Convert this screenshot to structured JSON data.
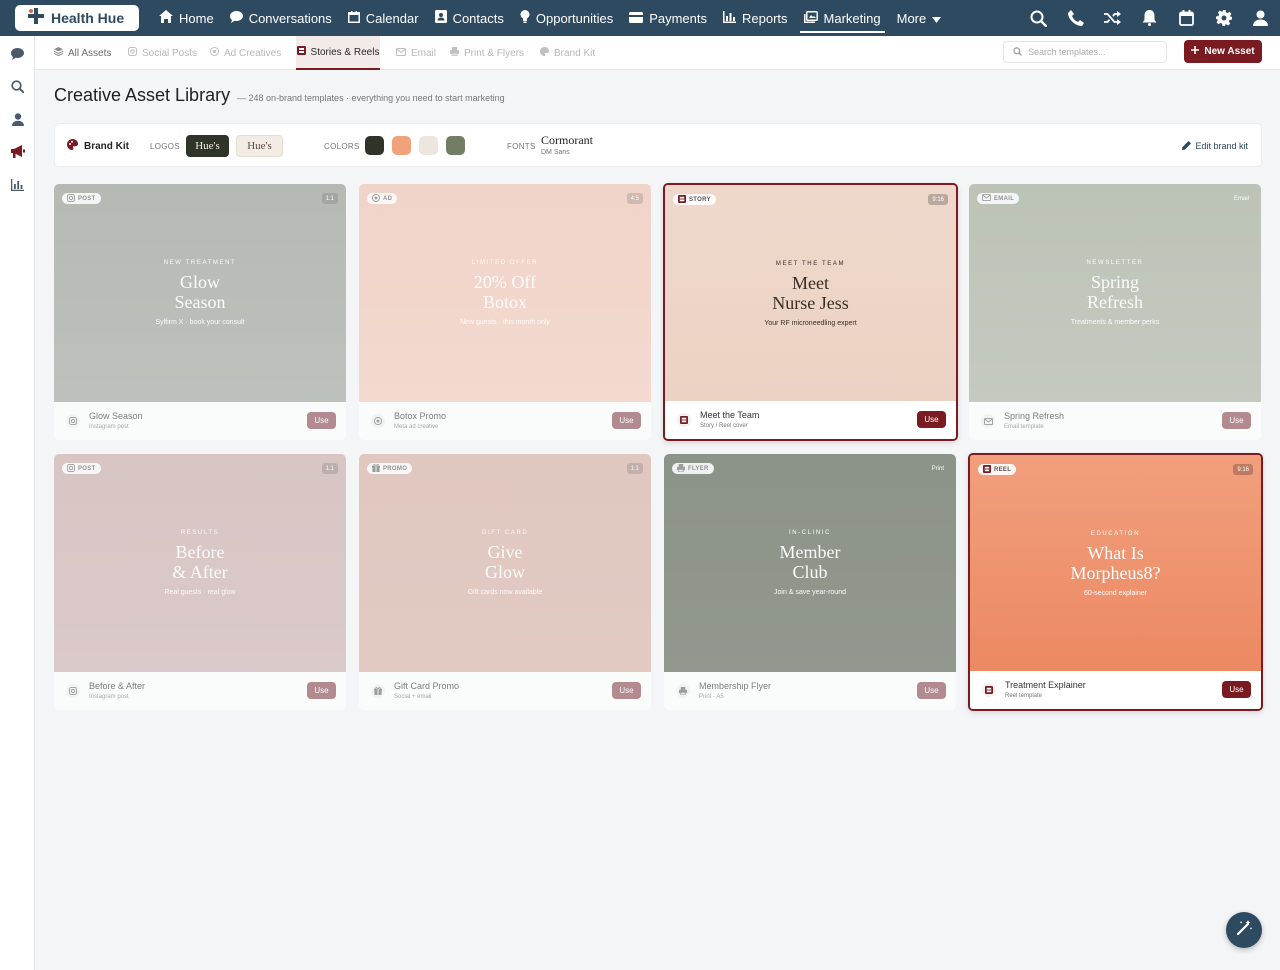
{
  "app": {
    "logo_text": "Health Hue"
  },
  "nav": {
    "items": [
      {
        "label": "Home",
        "icon": "home-icon"
      },
      {
        "label": "Conversations",
        "icon": "chat-icon"
      },
      {
        "label": "Calendar",
        "icon": "calendar-icon"
      },
      {
        "label": "Contacts",
        "icon": "contacts-icon"
      },
      {
        "label": "Opportunities",
        "icon": "lightbulb-icon"
      },
      {
        "label": "Payments",
        "icon": "credit-card-icon"
      },
      {
        "label": "Reports",
        "icon": "bar-chart-icon"
      },
      {
        "label": "Marketing",
        "icon": "marketing-icon",
        "active": true
      },
      {
        "label": "More",
        "icon": "chevron-down-icon"
      }
    ],
    "right_icons": [
      "search-icon",
      "phone-icon",
      "shuffle-icon",
      "bell-icon",
      "calendar-icon",
      "gear-icon",
      "user-icon"
    ]
  },
  "rail": {
    "icons": [
      "chat-icon",
      "search-icon",
      "user-icon",
      "megaphone-icon",
      "chart-icon"
    ]
  },
  "subnav": {
    "tabs": [
      {
        "label": "All Assets",
        "icon": "layers-icon"
      },
      {
        "label": "Social Posts",
        "icon": "instagram-icon"
      },
      {
        "label": "Ad Creatives",
        "icon": "target-icon"
      },
      {
        "label": "Stories & Reels",
        "icon": "film-icon",
        "active": true
      },
      {
        "label": "Email",
        "icon": "mail-icon"
      },
      {
        "label": "Print & Flyers",
        "icon": "printer-icon"
      },
      {
        "label": "Brand Kit",
        "icon": "palette-icon"
      }
    ],
    "search_placeholder": "Search templates...",
    "new_asset_label": "New Asset"
  },
  "header": {
    "title": "Creative Asset Library",
    "subtitle": "— 248 on-brand templates · everything you need to start marketing"
  },
  "brand_kit": {
    "title": "Brand Kit",
    "logos_label": "LOGOS",
    "logo_dark": "Hue's",
    "logo_light": "Hue's",
    "colors_label": "COLORS",
    "colors": [
      "#2f3428",
      "#f0a27a",
      "#ece6df",
      "#737d64"
    ],
    "fonts_label": "FONTS",
    "font_primary": "Cormorant",
    "font_secondary": "DM Sans",
    "edit_label": "Edit brand kit"
  },
  "cards": [
    {
      "badge": "POST",
      "badge_icon": "instagram-icon",
      "ratio": "1:1",
      "kicker": "NEW TREATMENT",
      "headline_1": "Glow",
      "headline_2": "Season",
      "tagline": "Sylfirm X · book your consult",
      "name": "Glow Season",
      "type": "Instagram post",
      "use": "Use",
      "bg": "linear-gradient(180deg,#8f968c 0%,#9da29a 100%)",
      "state": "faded",
      "footer_icon": "instagram-icon"
    },
    {
      "badge": "AD",
      "badge_icon": "target-icon",
      "ratio": "4:5",
      "kicker": "LIMITED OFFER",
      "headline_1": "20% Off",
      "headline_2": "Botox",
      "tagline": "New guests · this month only",
      "name": "Botox Promo",
      "type": "Meta ad creative",
      "use": "Use",
      "bg": "linear-gradient(180deg,#efbfad 0%,#f3c9b8 100%)",
      "state": "faded",
      "footer_icon": "target-icon"
    },
    {
      "badge": "STORY",
      "badge_icon": "film-icon",
      "ratio": "9:16",
      "kicker": "MEET THE TEAM",
      "headline_1": "Meet",
      "headline_2": "Nurse Jess",
      "tagline": "Your RF microneedling expert",
      "name": "Meet the Team",
      "type": "Story / Reel cover",
      "use": "Use",
      "bg": "linear-gradient(180deg,#efd8cb 0%,#ecd2c3 100%)",
      "state": "highlight dark",
      "footer_icon": "film-icon"
    },
    {
      "badge": "EMAIL",
      "badge_icon": "mail-icon",
      "ratio": "Email",
      "kicker": "NEWSLETTER",
      "headline_1": "Spring",
      "headline_2": "Refresh",
      "tagline": "Treatments & member perks",
      "name": "Spring Refresh",
      "type": "Email template",
      "use": "Use",
      "bg": "linear-gradient(180deg,#9aa58f 0%,#a9b09f 100%)",
      "state": "faded",
      "footer_icon": "mail-icon"
    },
    {
      "badge": "POST",
      "badge_icon": "instagram-icon",
      "ratio": "1:1",
      "kicker": "RESULTS",
      "headline_1": "Before",
      "headline_2": "& After",
      "tagline": "Real guests · real glow",
      "name": "Before & After",
      "type": "Instagram post",
      "use": "Use",
      "bg": "linear-gradient(180deg,#c7a9a6 0%,#cbb0ad 100%)",
      "state": "faded",
      "footer_icon": "instagram-icon"
    },
    {
      "badge": "PROMO",
      "badge_icon": "gift-icon",
      "ratio": "1:1",
      "kicker": "GIFT CARD",
      "headline_1": "Give",
      "headline_2": "Glow",
      "tagline": "Gift cards now available",
      "name": "Gift Card Promo",
      "type": "Social + email",
      "use": "Use",
      "bg": "linear-gradient(180deg,#d5ab9e 0%,#d8b1a4 100%)",
      "state": "faded",
      "footer_icon": "gift-icon"
    },
    {
      "badge": "FLYER",
      "badge_icon": "printer-icon",
      "ratio": "Print",
      "kicker": "IN-CLINIC",
      "headline_1": "Member",
      "headline_2": "Club",
      "tagline": "Join & save year-round",
      "name": "Membership Flyer",
      "type": "Print · A5",
      "use": "Use",
      "bg": "linear-gradient(180deg,#4d5845 0%,#57604f 100%)",
      "state": "faded",
      "footer_icon": "printer-icon"
    },
    {
      "badge": "REEL",
      "badge_icon": "film-icon",
      "ratio": "9:16",
      "kicker": "EDUCATION",
      "headline_1": "What Is",
      "headline_2": "Morpheus8?",
      "tagline": "60-second explainer",
      "name": "Treatment Explainer",
      "type": "Reel template",
      "use": "Use",
      "bg": "linear-gradient(180deg,#f29f7d 0%,#eb8962 100%)",
      "state": "highlight",
      "footer_icon": "film-icon"
    }
  ],
  "fab": {
    "icon": "magic-wand-icon"
  }
}
